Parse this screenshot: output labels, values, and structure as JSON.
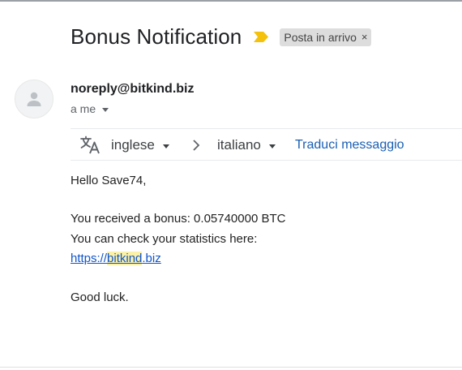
{
  "email": {
    "subject": "Bonus Notification",
    "label": "Posta in arrivo",
    "label_close": "×",
    "sender": "noreply@bitkind.biz",
    "recipient": "a me"
  },
  "translate": {
    "source_language": "inglese",
    "target_language": "italiano",
    "translate_link": "Traduci messaggio"
  },
  "body": {
    "greeting": "Hello Save74,",
    "bonus_line": "You received a bonus: 0.05740000 BTC",
    "stats_line": "You can check your statistics here:",
    "link_prefix": "https://",
    "link_domain": "bitkind",
    "link_suffix": ".biz",
    "closing": "Good luck."
  },
  "colors": {
    "importance_marker": "#f4c20d",
    "link": "#1155cc",
    "translate_link": "#1a5fb4",
    "highlight": "#fbf1a9"
  }
}
